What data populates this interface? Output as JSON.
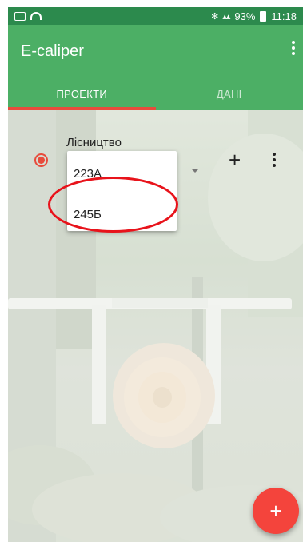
{
  "status_bar": {
    "battery": "93%",
    "time": "11:18",
    "icons": [
      "image-icon",
      "wifi-icon",
      "bluetooth-icon",
      "signal-icon",
      "battery-icon"
    ]
  },
  "app_bar": {
    "title": "E-caliper",
    "overflow_icon": "more-vertical-icon"
  },
  "tabs": [
    {
      "label": "ПРОЕКТИ",
      "active": true
    },
    {
      "label": "ДАНІ",
      "active": false
    }
  ],
  "project": {
    "label": "Лісництво",
    "selected": true,
    "options": [
      "223А",
      "245Б"
    ],
    "add_icon": "plus-icon",
    "more_icon": "more-vertical-icon"
  },
  "fab": {
    "label": "+"
  },
  "colors": {
    "status_bar": "#2c8a4d",
    "app_bar": "#4caf65",
    "accent": "#e84b3c",
    "fab": "#f4443c",
    "highlight": "#e8131b"
  }
}
